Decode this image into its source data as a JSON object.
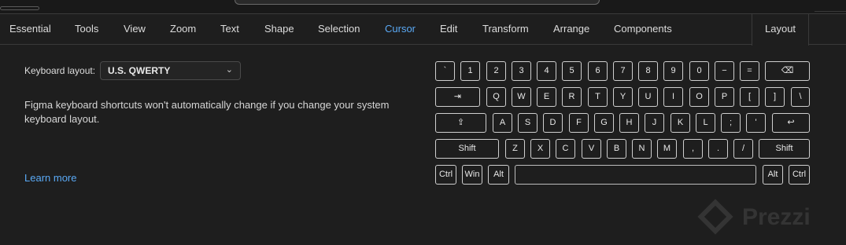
{
  "tabs": [
    {
      "label": "Essential"
    },
    {
      "label": "Tools"
    },
    {
      "label": "View"
    },
    {
      "label": "Zoom"
    },
    {
      "label": "Text"
    },
    {
      "label": "Shape"
    },
    {
      "label": "Selection"
    },
    {
      "label": "Cursor",
      "accent": "#5aa9f5"
    },
    {
      "label": "Edit"
    },
    {
      "label": "Transform"
    },
    {
      "label": "Arrange"
    },
    {
      "label": "Components"
    },
    {
      "label": "Layout",
      "active": true
    }
  ],
  "keyboard_layout": {
    "label": "Keyboard layout:",
    "selected": "U.S. QWERTY",
    "chevron": "⌄"
  },
  "description": "Figma keyboard shortcuts won't automatically change if you change your system keyboard layout.",
  "learn_more": "Learn more",
  "keyboard": {
    "rows": [
      [
        "`",
        "1",
        "2",
        "3",
        "4",
        "5",
        "6",
        "7",
        "8",
        "9",
        "0",
        "−",
        "=",
        "⌫"
      ],
      [
        "⇥",
        "Q",
        "W",
        "E",
        "R",
        "T",
        "Y",
        "U",
        "I",
        "O",
        "P",
        "[",
        "]",
        "\\"
      ],
      [
        "⇪",
        "A",
        "S",
        "D",
        "F",
        "G",
        "H",
        "J",
        "K",
        "L",
        ";",
        "'",
        "↩"
      ],
      [
        "Shift",
        "Z",
        "X",
        "C",
        "V",
        "B",
        "N",
        "M",
        ",",
        ".",
        "/",
        "Shift"
      ],
      [
        "Ctrl",
        "Win",
        "Alt",
        "",
        "Alt",
        "Ctrl"
      ]
    ]
  },
  "watermark": {
    "text": "Prezzi"
  },
  "colors": {
    "accent": "#5aa9f5",
    "background": "#1e1e1e"
  }
}
